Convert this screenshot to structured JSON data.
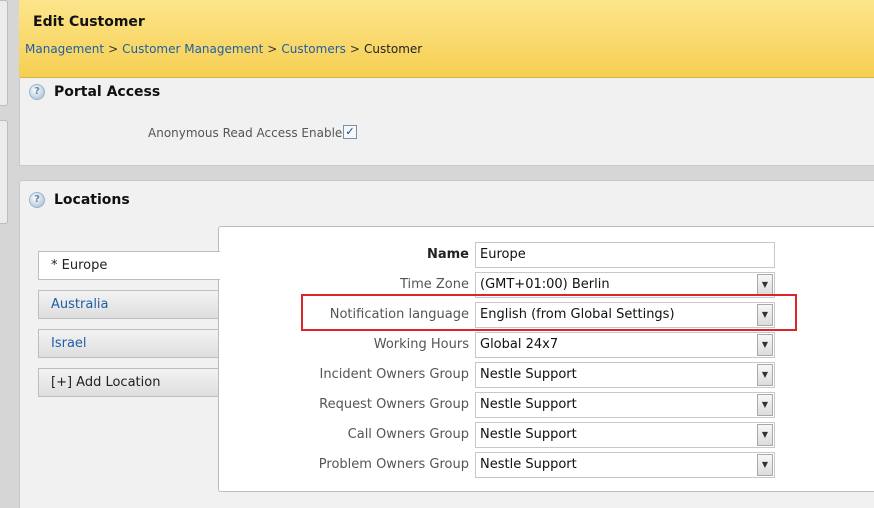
{
  "header": {
    "title": "Edit Customer",
    "breadcrumb": [
      {
        "label": "Management",
        "link": true
      },
      {
        "label": "Customer Management",
        "link": true
      },
      {
        "label": "Customers",
        "link": true
      },
      {
        "label": "Customer",
        "link": false
      }
    ],
    "separator": ">"
  },
  "portal_access": {
    "title": "Portal Access",
    "anonymous_label": "Anonymous Read Access Enabled?",
    "anonymous_checked": true
  },
  "locations": {
    "title": "Locations",
    "tabs": [
      {
        "label": "* Europe",
        "active": true
      },
      {
        "label": "Australia",
        "active": false
      },
      {
        "label": "Israel",
        "active": false
      }
    ],
    "add_label": "[+] Add Location",
    "form": {
      "name_label": "Name",
      "name_value": "Europe",
      "fields": [
        {
          "label": "Time Zone",
          "value": "(GMT+01:00) Berlin"
        },
        {
          "label": "Notification language",
          "value": "English (from Global Settings)"
        },
        {
          "label": "Working Hours",
          "value": "Global 24x7"
        },
        {
          "label": "Incident Owners Group",
          "value": "Nestle Support"
        },
        {
          "label": "Request Owners Group",
          "value": "Nestle Support"
        },
        {
          "label": "Call Owners Group",
          "value": "Nestle Support"
        },
        {
          "label": "Problem Owners Group",
          "value": "Nestle Support"
        }
      ]
    }
  },
  "icons": {
    "help": "help-icon",
    "dropdown": "chevron-down-icon",
    "check": "checkmark-icon"
  },
  "colors": {
    "header_bg": "#f6cf52",
    "link": "#1f5fa6",
    "highlight": "#d8262b"
  }
}
